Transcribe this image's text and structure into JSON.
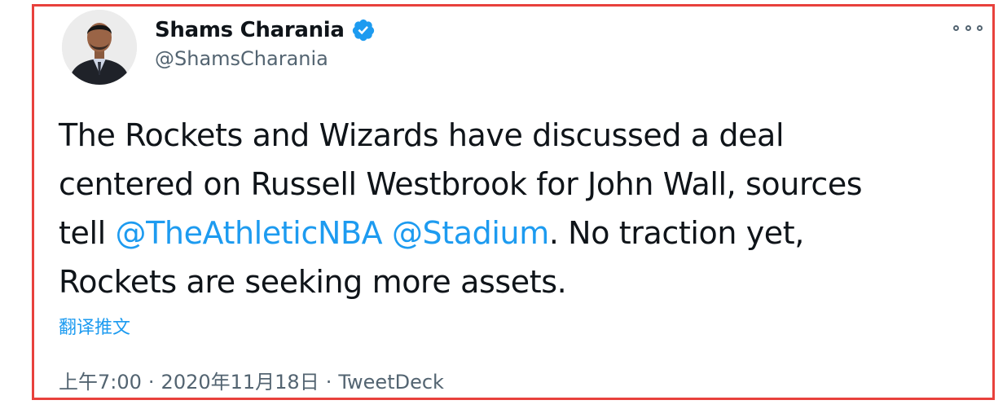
{
  "author": {
    "display_name": "Shams Charania",
    "handle": "@ShamsCharania",
    "verified": true,
    "verified_color": "#1d9bf0"
  },
  "tweet": {
    "text_line1": "The Rockets and Wizards have discussed a deal",
    "text_line2": "centered on Russell Westbrook for John Wall, sources",
    "text_line3_prefix": "tell ",
    "mention_1": "@TheAthleticNBA",
    "text_line3_mid": " ",
    "mention_2": "@Stadium",
    "text_line3_suffix": ". No traction yet,",
    "text_line4": "Rockets are seeking more assets."
  },
  "translate_label": "翻译推文",
  "meta": {
    "time": "上午7:00",
    "separator": "·",
    "date": "2020年11月18日",
    "source": "TweetDeck"
  },
  "icons": {
    "more": "more-options-icon",
    "verified": "verified-badge-icon"
  },
  "colors": {
    "highlight_frame": "#e8413c",
    "link": "#1d9bf0",
    "text": "#0f1419",
    "muted": "#536471"
  }
}
